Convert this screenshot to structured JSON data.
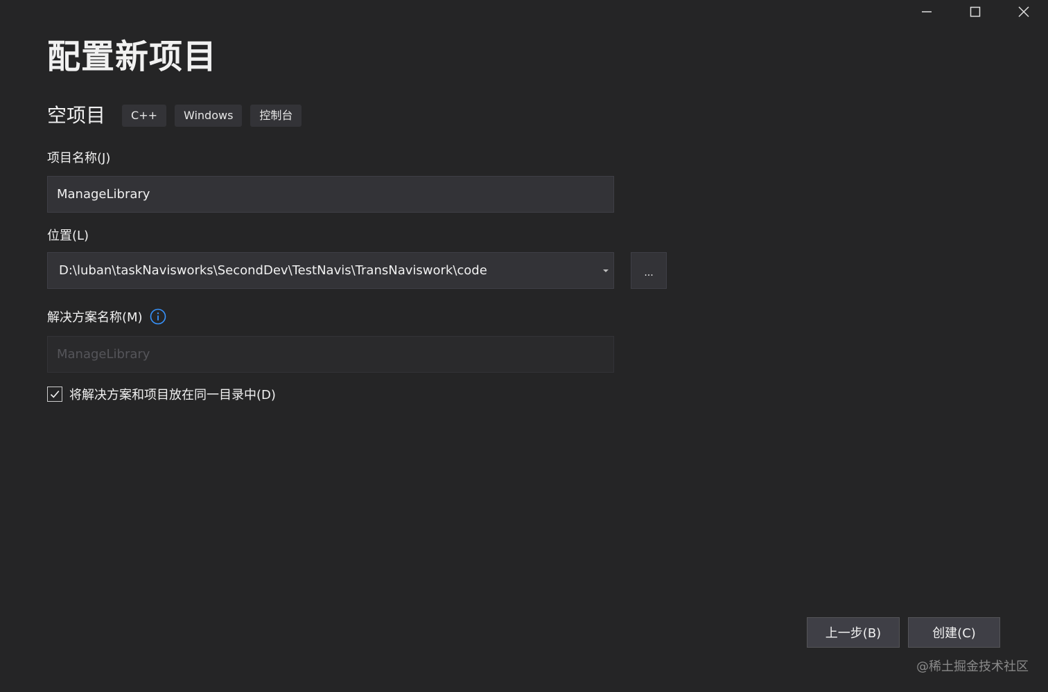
{
  "window": {
    "minimize_label": "",
    "maximize_label": "",
    "close_label": ""
  },
  "page_title": "配置新项目",
  "template": {
    "name": "空项目",
    "tags": [
      "C++",
      "Windows",
      "控制台"
    ]
  },
  "project_name": {
    "label": "项目名称(J)",
    "value": "ManageLibrary"
  },
  "location": {
    "label": "位置(L)",
    "value": "D:\\luban\\taskNavisworks\\SecondDev\\TestNavis\\TransNaviswork\\code",
    "browse_label": "..."
  },
  "solution_name": {
    "label": "解决方案名称(M)",
    "placeholder": "ManageLibrary"
  },
  "same_directory": {
    "label": "将解决方案和项目放在同一目录中(D)",
    "checked": true
  },
  "footer": {
    "back_label": "上一步(B)",
    "create_label": "创建(C)"
  },
  "watermark": "@稀土掘金技术社区",
  "colors": {
    "background": "#252526",
    "input_background": "#333337",
    "info_icon": "#3794ff"
  }
}
